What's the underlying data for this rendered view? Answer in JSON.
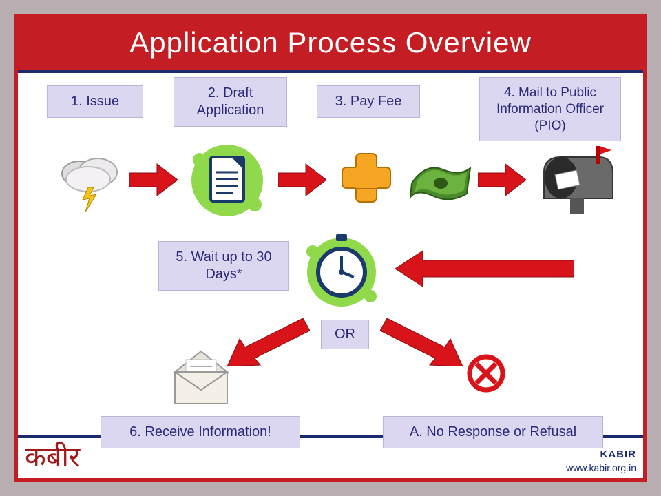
{
  "title": "Application Process Overview",
  "steps": {
    "s1": "1. Issue",
    "s2": "2. Draft Application",
    "s3": "3. Pay Fee",
    "s4": "4. Mail to Public Information Officer (PIO)",
    "s5": "5. Wait up to 30 Days*",
    "or": "OR",
    "s6": "6. Receive Information!",
    "sA": "A. No Response or Refusal"
  },
  "footer": {
    "left": "कबीर",
    "org": "KABIR",
    "url": "www.kabir.org.in"
  }
}
